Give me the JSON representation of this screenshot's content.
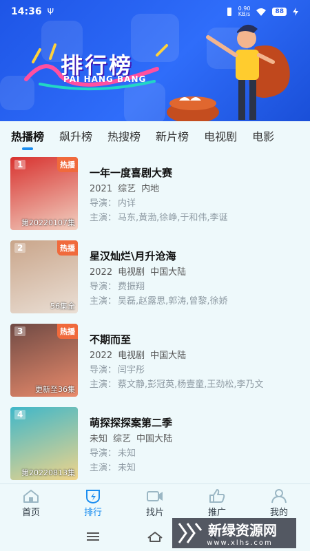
{
  "status": {
    "time": "14:36",
    "usb_icon": "usb-icon",
    "net_speed": "0.90",
    "net_unit": "KB/s",
    "battery": "88"
  },
  "banner": {
    "title": "排行榜",
    "subtitle": "PAI HANG BANG"
  },
  "tabs": [
    "热播榜",
    "飙升榜",
    "热搜榜",
    "新片榜",
    "电视剧",
    "电影"
  ],
  "list": [
    {
      "rank": "1",
      "badge": "热播",
      "episode": "第20220107集",
      "title": "一年一度喜剧大赛",
      "year": "2021",
      "genre": "综艺",
      "region": "内地",
      "director_label": "导演：",
      "director": "内详",
      "cast_label": "主演：",
      "cast": "马东,黄渤,徐峥,于和伟,李诞",
      "colors": [
        "#d8322f",
        "#f1d0c1"
      ]
    },
    {
      "rank": "2",
      "badge": "热播",
      "episode": "56集全",
      "title": "星汉灿烂\\月升沧海",
      "year": "2022",
      "genre": "电视剧",
      "region": "中国大陆",
      "director_label": "导演：",
      "director": "费振翔",
      "cast_label": "主演：",
      "cast": "吴磊,赵露思,郭涛,曾黎,徐娇",
      "colors": [
        "#c9a58a",
        "#eadfd5"
      ]
    },
    {
      "rank": "3",
      "badge": "热播",
      "episode": "更新至36集",
      "title": "不期而至",
      "year": "2022",
      "genre": "电视剧",
      "region": "中国大陆",
      "director_label": "导演：",
      "director": "闫宇彤",
      "cast_label": "主演：",
      "cast": "蔡文静,彭冠英,杨壹童,王劲松,李乃文",
      "colors": [
        "#6f4a44",
        "#e98b6c"
      ]
    },
    {
      "rank": "4",
      "badge": "",
      "episode": "第20220813集",
      "title": "萌探探探案第二季",
      "year": "未知",
      "genre": "综艺",
      "region": "中国大陆",
      "director_label": "导演：",
      "director": "未知",
      "cast_label": "主演：",
      "cast": "未知",
      "colors": [
        "#3fb7c9",
        "#f0d48a"
      ]
    }
  ],
  "nav": [
    {
      "label": "首页",
      "icon": "home-icon"
    },
    {
      "label": "排行",
      "icon": "ranking-icon"
    },
    {
      "label": "找片",
      "icon": "video-camera-icon"
    },
    {
      "label": "推广",
      "icon": "thumbs-up-icon"
    },
    {
      "label": "我的",
      "icon": "user-icon"
    }
  ],
  "watermark": {
    "name": "新绿资源网",
    "url": "www.xlhs.com"
  }
}
